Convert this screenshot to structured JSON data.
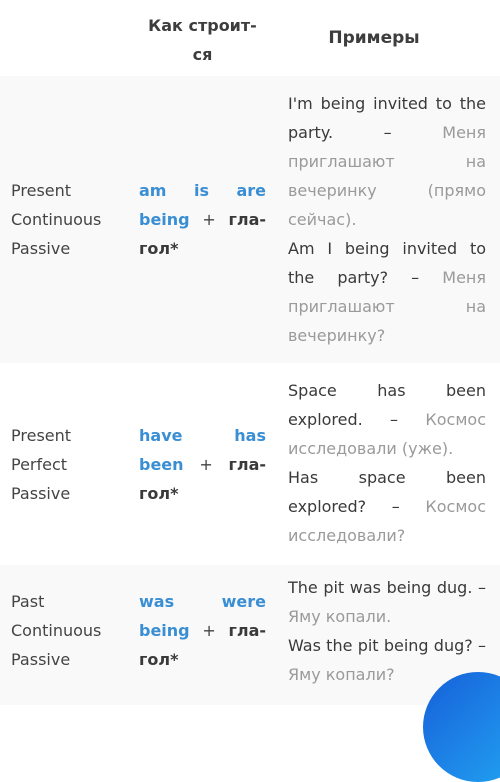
{
  "header": {
    "col_name": "",
    "col_form": "Как строит-ся",
    "col_examples": "Примеры"
  },
  "rows": [
    {
      "name": [
        "Present",
        "Continuous",
        "Passive"
      ],
      "form": {
        "aux": [
          "am",
          "is",
          "are"
        ],
        "participle": "being",
        "plus": "+",
        "verb_part1": "гла-",
        "verb_part2": "гол*"
      },
      "examples": [
        {
          "en": "I'm being invited to the party. –",
          "ru": "Меня приглашают на вечеринку (прямо сейчас)."
        },
        {
          "en": "Am I being invited to the party? –",
          "ru": "Меня приглашают на вечеринку?"
        }
      ]
    },
    {
      "name": [
        "Present",
        "Perfect",
        "Passive"
      ],
      "form": {
        "aux": [
          "have",
          "has"
        ],
        "participle": "been",
        "plus": "+",
        "verb_part1": "гла-",
        "verb_part2": "гол*"
      },
      "examples": [
        {
          "en": "Space has been explored. –",
          "ru": "Космос исследовали (уже)."
        },
        {
          "en": "Has space been explored? –",
          "ru": "Космос исследовали?"
        }
      ]
    },
    {
      "name": [
        "Past",
        "Continuous",
        "Passive"
      ],
      "form": {
        "aux": [
          "was",
          "were"
        ],
        "participle": "being",
        "plus": "+",
        "verb_part1": "гла-",
        "verb_part2": "гол*"
      },
      "examples": [
        {
          "en": "The pit was being dug. –",
          "ru": "Яму копали."
        },
        {
          "en": "Was the pit being dug? –",
          "ru": "Яму копали?"
        }
      ]
    }
  ],
  "colors": {
    "accent_blue": "#3a8fd4",
    "text_dark": "#3a3a3a",
    "text_translation": "#9a9a9a",
    "row_stripe": "#f9f9f9",
    "fab_blue": "#1e86e8"
  }
}
